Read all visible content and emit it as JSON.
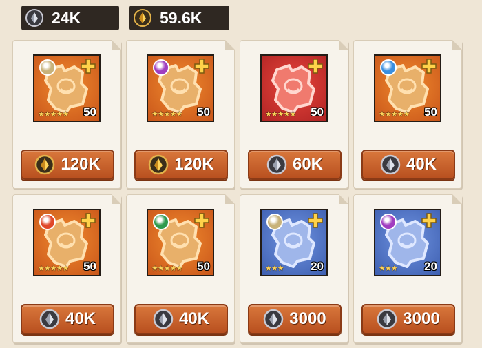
{
  "resources": [
    {
      "name": "silver-currency",
      "amount": "24K",
      "icon": "silver-crystal-icon"
    },
    {
      "name": "gold-currency",
      "amount": "59.6K",
      "icon": "gold-crystal-icon"
    }
  ],
  "colors": {
    "orange_tile": "#e0742a",
    "red_tile": "#d8322c",
    "blue_tile": "#5a7ed0",
    "button": "#c65f28"
  },
  "items": [
    {
      "tile": "orange",
      "element": "light",
      "element_color": "#c8b27a",
      "stars": "★★★★★",
      "level": "50",
      "price": "120K",
      "currency": "gold"
    },
    {
      "tile": "orange",
      "element": "dark",
      "element_color": "#a03ec0",
      "stars": "★★★★★",
      "level": "50",
      "price": "120K",
      "currency": "gold"
    },
    {
      "tile": "red",
      "element": "none",
      "element_color": "",
      "stars": "★★★★★",
      "level": "50",
      "price": "60K",
      "currency": "silver"
    },
    {
      "tile": "orange",
      "element": "water",
      "element_color": "#3a8fe0",
      "stars": "★★★★★",
      "level": "50",
      "price": "40K",
      "currency": "silver"
    },
    {
      "tile": "orange",
      "element": "fire",
      "element_color": "#e0482a",
      "stars": "★★★★★",
      "level": "50",
      "price": "40K",
      "currency": "silver"
    },
    {
      "tile": "orange",
      "element": "earth",
      "element_color": "#2e9a4e",
      "stars": "★★★★★",
      "level": "50",
      "price": "40K",
      "currency": "silver"
    },
    {
      "tile": "blue",
      "element": "light",
      "element_color": "#c8b27a",
      "stars": "★★★",
      "level": "20",
      "price": "3000",
      "currency": "silver"
    },
    {
      "tile": "blue",
      "element": "dark",
      "element_color": "#a03ec0",
      "stars": "★★★",
      "level": "20",
      "price": "3000",
      "currency": "silver"
    }
  ]
}
